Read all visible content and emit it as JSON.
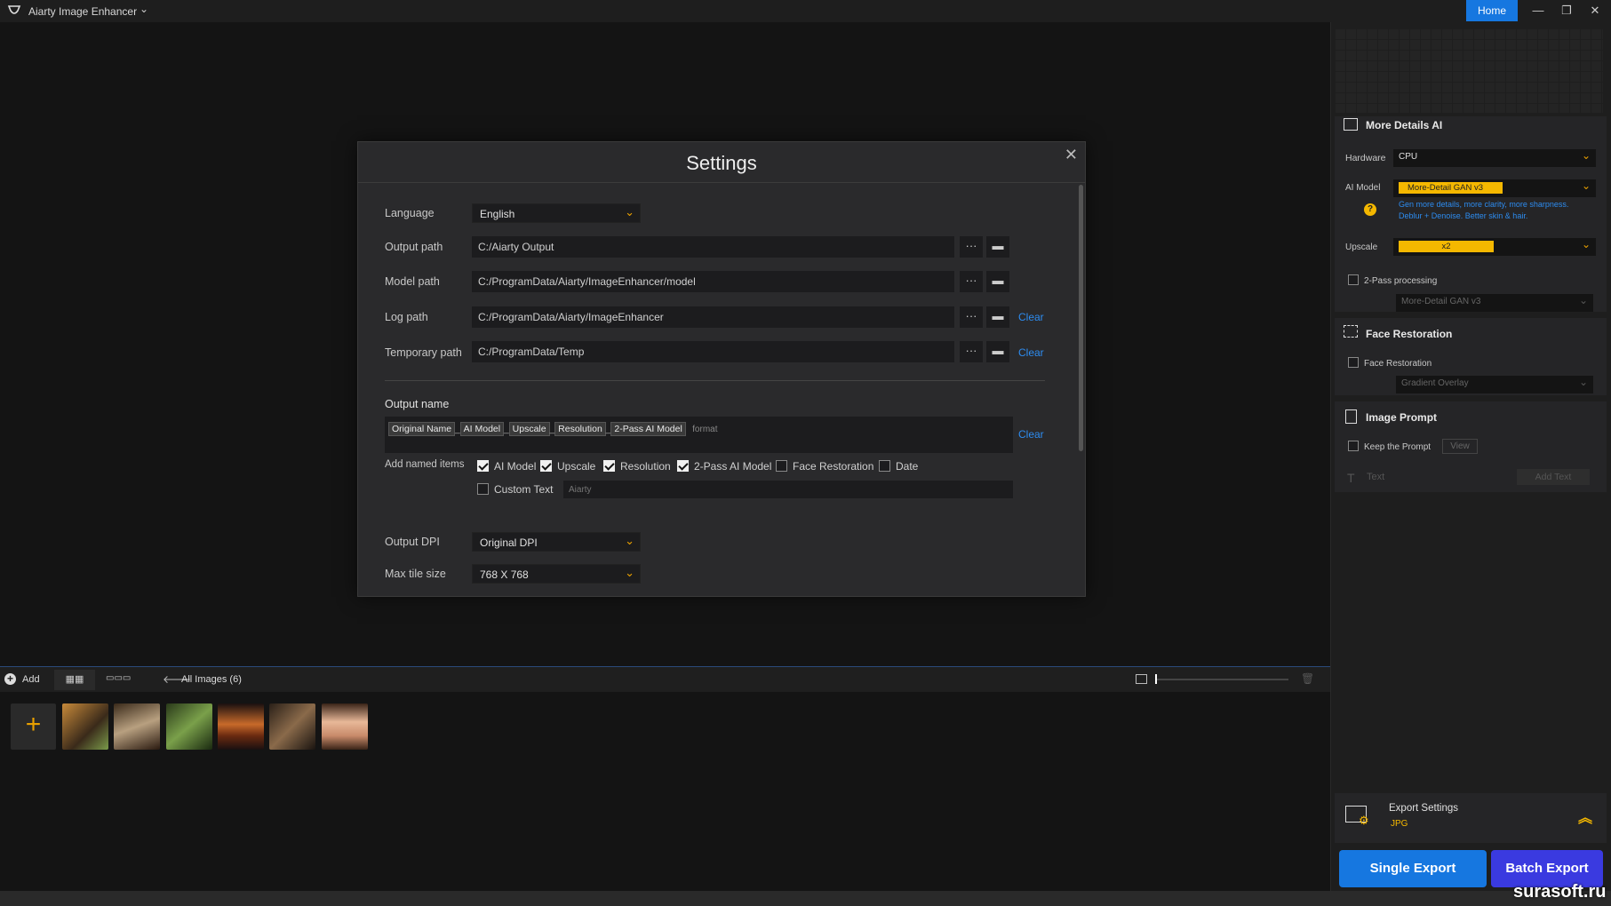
{
  "app": {
    "title": "Aiarty Image Enhancer",
    "home_label": "Home"
  },
  "window_controls": {
    "minimize": "—",
    "restore": "❐",
    "close": "✕"
  },
  "settings": {
    "title": "Settings",
    "close": "✕",
    "language": {
      "label": "Language",
      "value": "English"
    },
    "output_path": {
      "label": "Output path",
      "value": "C:/Aiarty Output"
    },
    "model_path": {
      "label": "Model path",
      "value": "C:/ProgramData/Aiarty/ImageEnhancer/model"
    },
    "log_path": {
      "label": "Log path",
      "value": "C:/ProgramData/Aiarty/ImageEnhancer",
      "clear": "Clear"
    },
    "temp_path": {
      "label": "Temporary path",
      "value": "C:/ProgramData/Temp",
      "clear": "Clear"
    },
    "more_label": "···",
    "output_name": {
      "label": "Output name",
      "tags": [
        "Original Name",
        "AI Model",
        "Upscale",
        "Resolution",
        "2-Pass AI Model"
      ],
      "separator": "_",
      "suffix": "format",
      "clear": "Clear"
    },
    "add_named_items": {
      "label": "Add named items",
      "items": [
        {
          "label": "AI Model",
          "checked": true
        },
        {
          "label": "Upscale",
          "checked": true
        },
        {
          "label": "Resolution",
          "checked": true
        },
        {
          "label": "2-Pass AI Model",
          "checked": true
        },
        {
          "label": "Face Restoration",
          "checked": false
        },
        {
          "label": "Date",
          "checked": false
        }
      ],
      "custom_text": {
        "label": "Custom Text",
        "checked": false,
        "placeholder": "Aiarty"
      }
    },
    "output_dpi": {
      "label": "Output DPI",
      "value": "Original DPI"
    },
    "max_tile": {
      "label": "Max tile size",
      "value": "768 X 768"
    }
  },
  "bottom_toolbar": {
    "add_label": "Add",
    "all_images": "All Images (6)"
  },
  "thumbnails": [
    {
      "name": "tiger",
      "color": "#8a6a3a"
    },
    {
      "name": "owl",
      "color": "#6a5a40"
    },
    {
      "name": "frog",
      "color": "#4a6a3a"
    },
    {
      "name": "burger",
      "color": "#8a4a2a"
    },
    {
      "name": "cat-warrior",
      "color": "#5a4a3a"
    },
    {
      "name": "woman",
      "color": "#c89a80"
    }
  ],
  "right_panel": {
    "more_details": {
      "title": "More Details AI",
      "hardware_label": "Hardware",
      "hardware_value": "CPU",
      "ai_model_label": "AI Model",
      "ai_model_value": "More-Detail GAN  v3",
      "ai_model_desc_1": "Gen more details, more clarity, more sharpness.",
      "ai_model_desc_2": "Deblur + Denoise. Better skin & hair.",
      "upscale_label": "Upscale",
      "upscale_value": "x2",
      "two_pass_label": "2-Pass processing",
      "two_pass_model": "More-Detail GAN  v3"
    },
    "face_restoration": {
      "title": "Face Restoration",
      "check_label": "Face Restoration",
      "model": "Gradient Overlay"
    },
    "image_prompt": {
      "title": "Image Prompt",
      "keep_label": "Keep the Prompt",
      "view_label": "View",
      "text_label": "Text",
      "add_text": "Add Text"
    },
    "export": {
      "title": "Export Settings",
      "format": "JPG",
      "single": "Single Export",
      "batch": "Batch Export"
    }
  },
  "watermark": "surasoft.ru",
  "colors": {
    "accent_blue": "#1677e0",
    "accent_yellow": "#f5b800",
    "link_blue": "#2d8cf0"
  }
}
